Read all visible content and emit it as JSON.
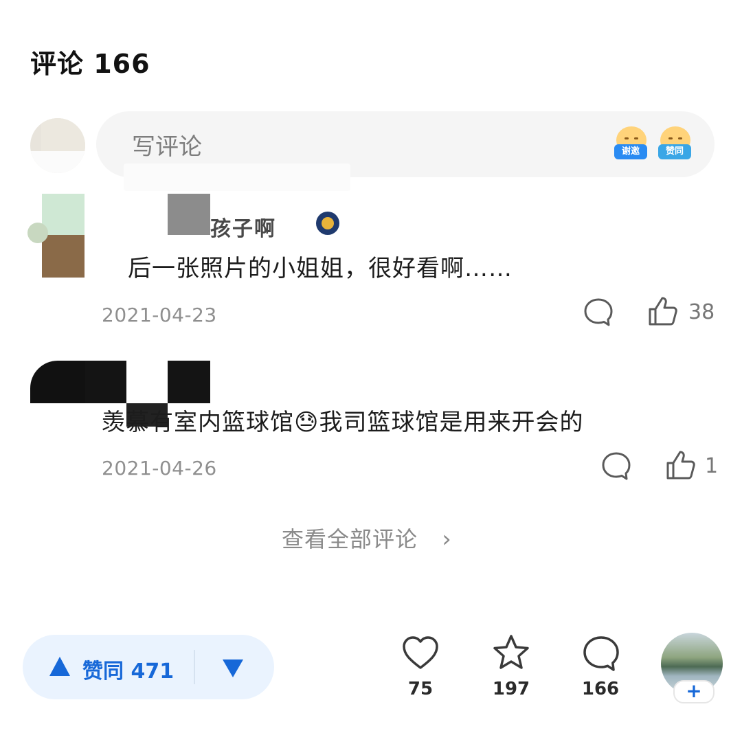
{
  "header": {
    "title": "评论 166"
  },
  "compose": {
    "placeholder": "写评论",
    "emoji_buttons": [
      {
        "label": "谢邀",
        "icon": "thanks-invite-emoji-icon",
        "color": "#2a8bf2"
      },
      {
        "label": "赞同",
        "icon": "agree-emoji-icon",
        "color": "#3aa6e6"
      }
    ]
  },
  "comments": [
    {
      "name_visible": "孩子啊",
      "text": "后一张照片的小姐姐，很好看啊……",
      "date": "2021-04-23",
      "likes": "38"
    },
    {
      "text": "羡慕有室内篮球馆😓我司篮球馆是用来开会的",
      "date": "2021-04-26",
      "likes": "1"
    }
  ],
  "view_all": {
    "label": "查看全部评论",
    "chevron": "›"
  },
  "bottom_bar": {
    "vote_up_label": "赞同 471",
    "like_count": "75",
    "favorite_count": "197",
    "comment_count": "166",
    "plus": "+",
    "accent_color": "#1768d8"
  }
}
